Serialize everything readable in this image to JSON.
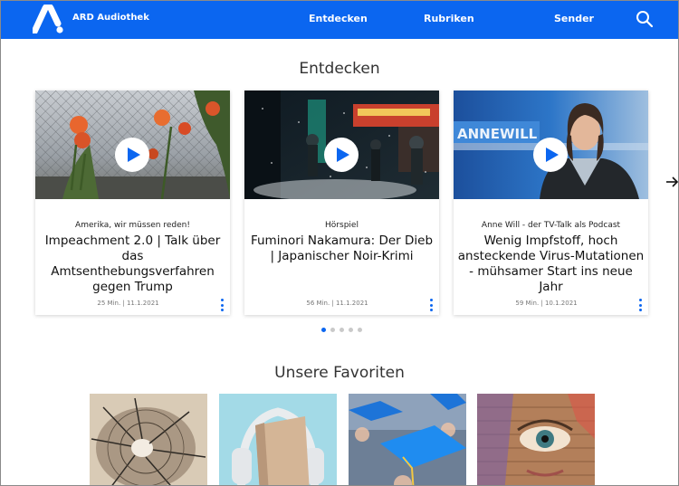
{
  "header": {
    "logo_text": "ARD Audiothek",
    "nav": [
      {
        "label": "Entdecken"
      },
      {
        "label": "Rubriken"
      },
      {
        "label": "Sender"
      }
    ],
    "search_icon": "search-icon"
  },
  "sections": {
    "discover_title": "Entdecken",
    "favorites_title": "Unsere Favoriten"
  },
  "cards": [
    {
      "kicker": "Amerika, wir müssen reden!",
      "title": "Impeachment 2.0 | Talk über das Amtsenthebungsverfahren gegen Trump",
      "meta": "25 Min.  |  11.1.2021"
    },
    {
      "kicker": "Hörspiel",
      "title": "Fuminori Nakamura: Der Dieb | Japanischer Noir-Krimi",
      "meta": "56 Min.  |  11.1.2021"
    },
    {
      "kicker": "Anne Will - der TV-Talk als Podcast",
      "title": "Wenig Impfstoff, hoch ansteckende Virus-Mutationen - mühsamer Start ins neue Jahr",
      "meta": "59 Min.  |  10.1.2021"
    }
  ],
  "carousel": {
    "active_page": 1,
    "page_count": 5
  },
  "colors": {
    "brand": "#0b66f0",
    "dot_inactive": "#c9c9c9"
  }
}
